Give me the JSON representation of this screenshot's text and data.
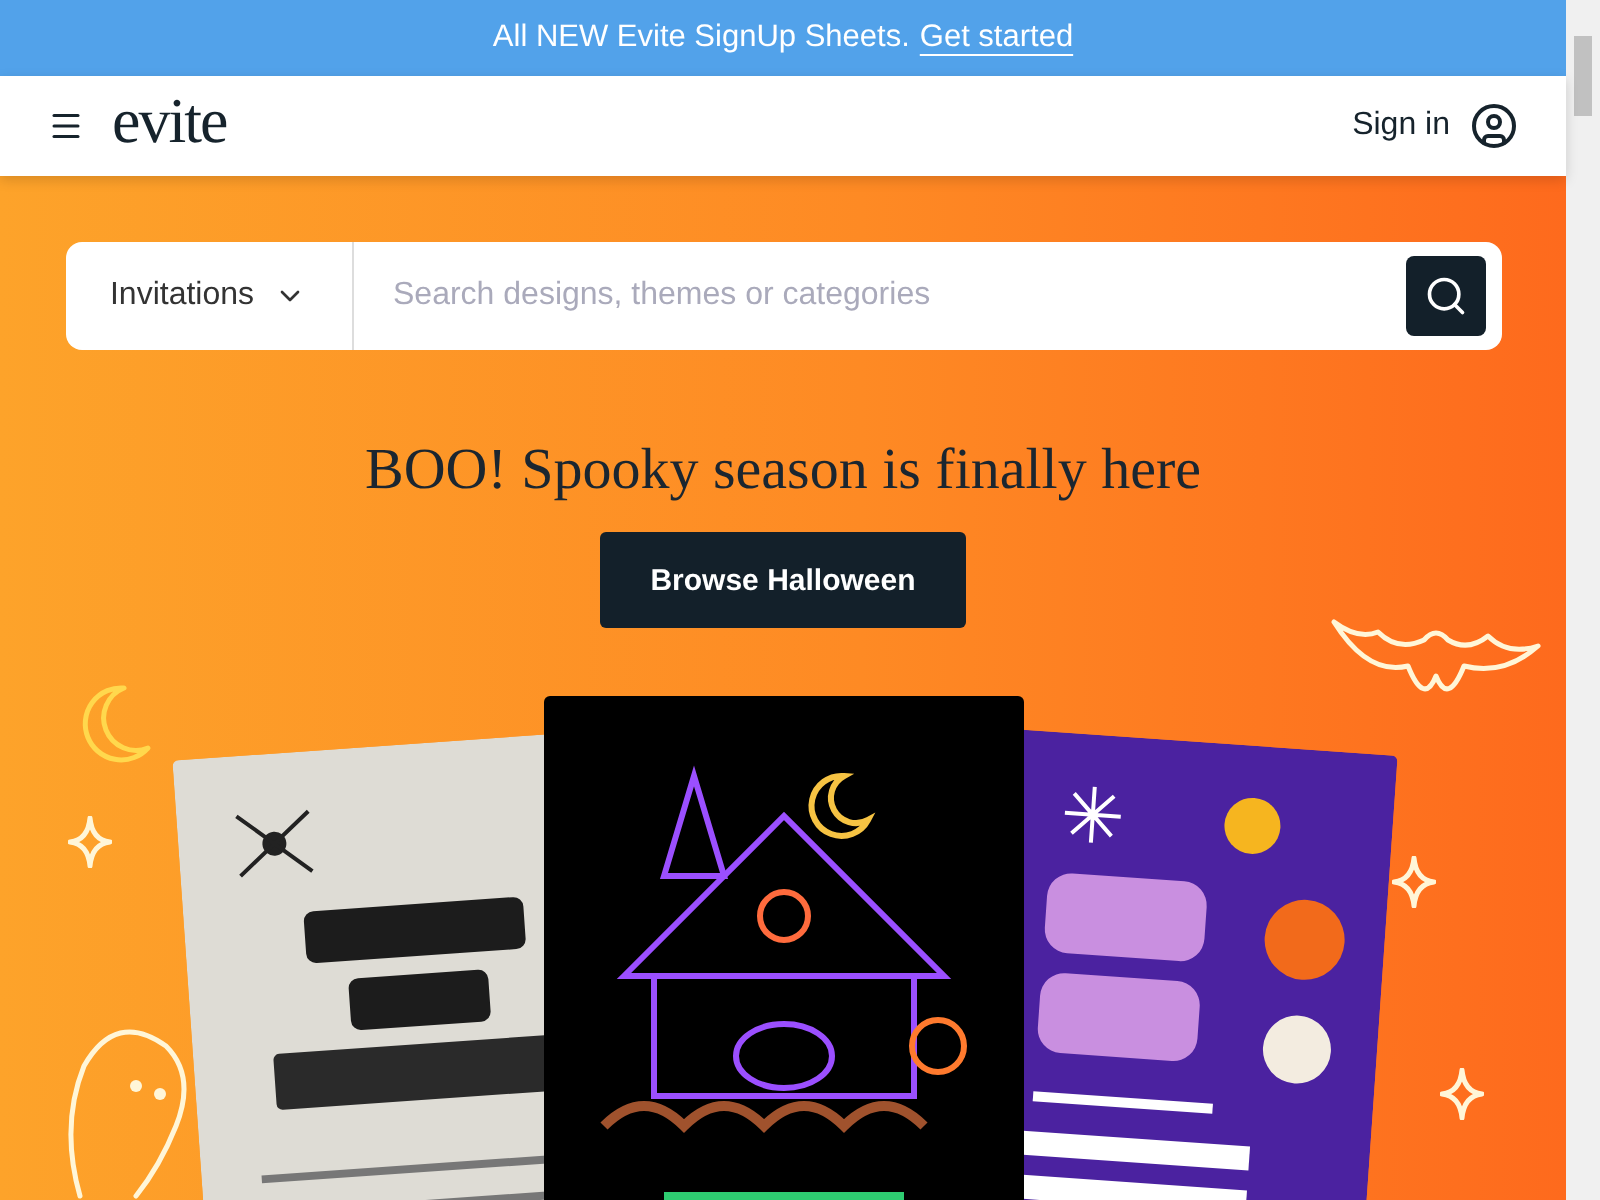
{
  "banner": {
    "text": "All NEW Evite SignUp Sheets.",
    "link": "Get started"
  },
  "header": {
    "logo": "evite",
    "sign_in": "Sign in"
  },
  "search": {
    "category": "Invitations",
    "placeholder": "Search designs, themes or categories"
  },
  "hero": {
    "headline": "BOO! Spooky season is finally here",
    "button": "Browse Halloween"
  }
}
